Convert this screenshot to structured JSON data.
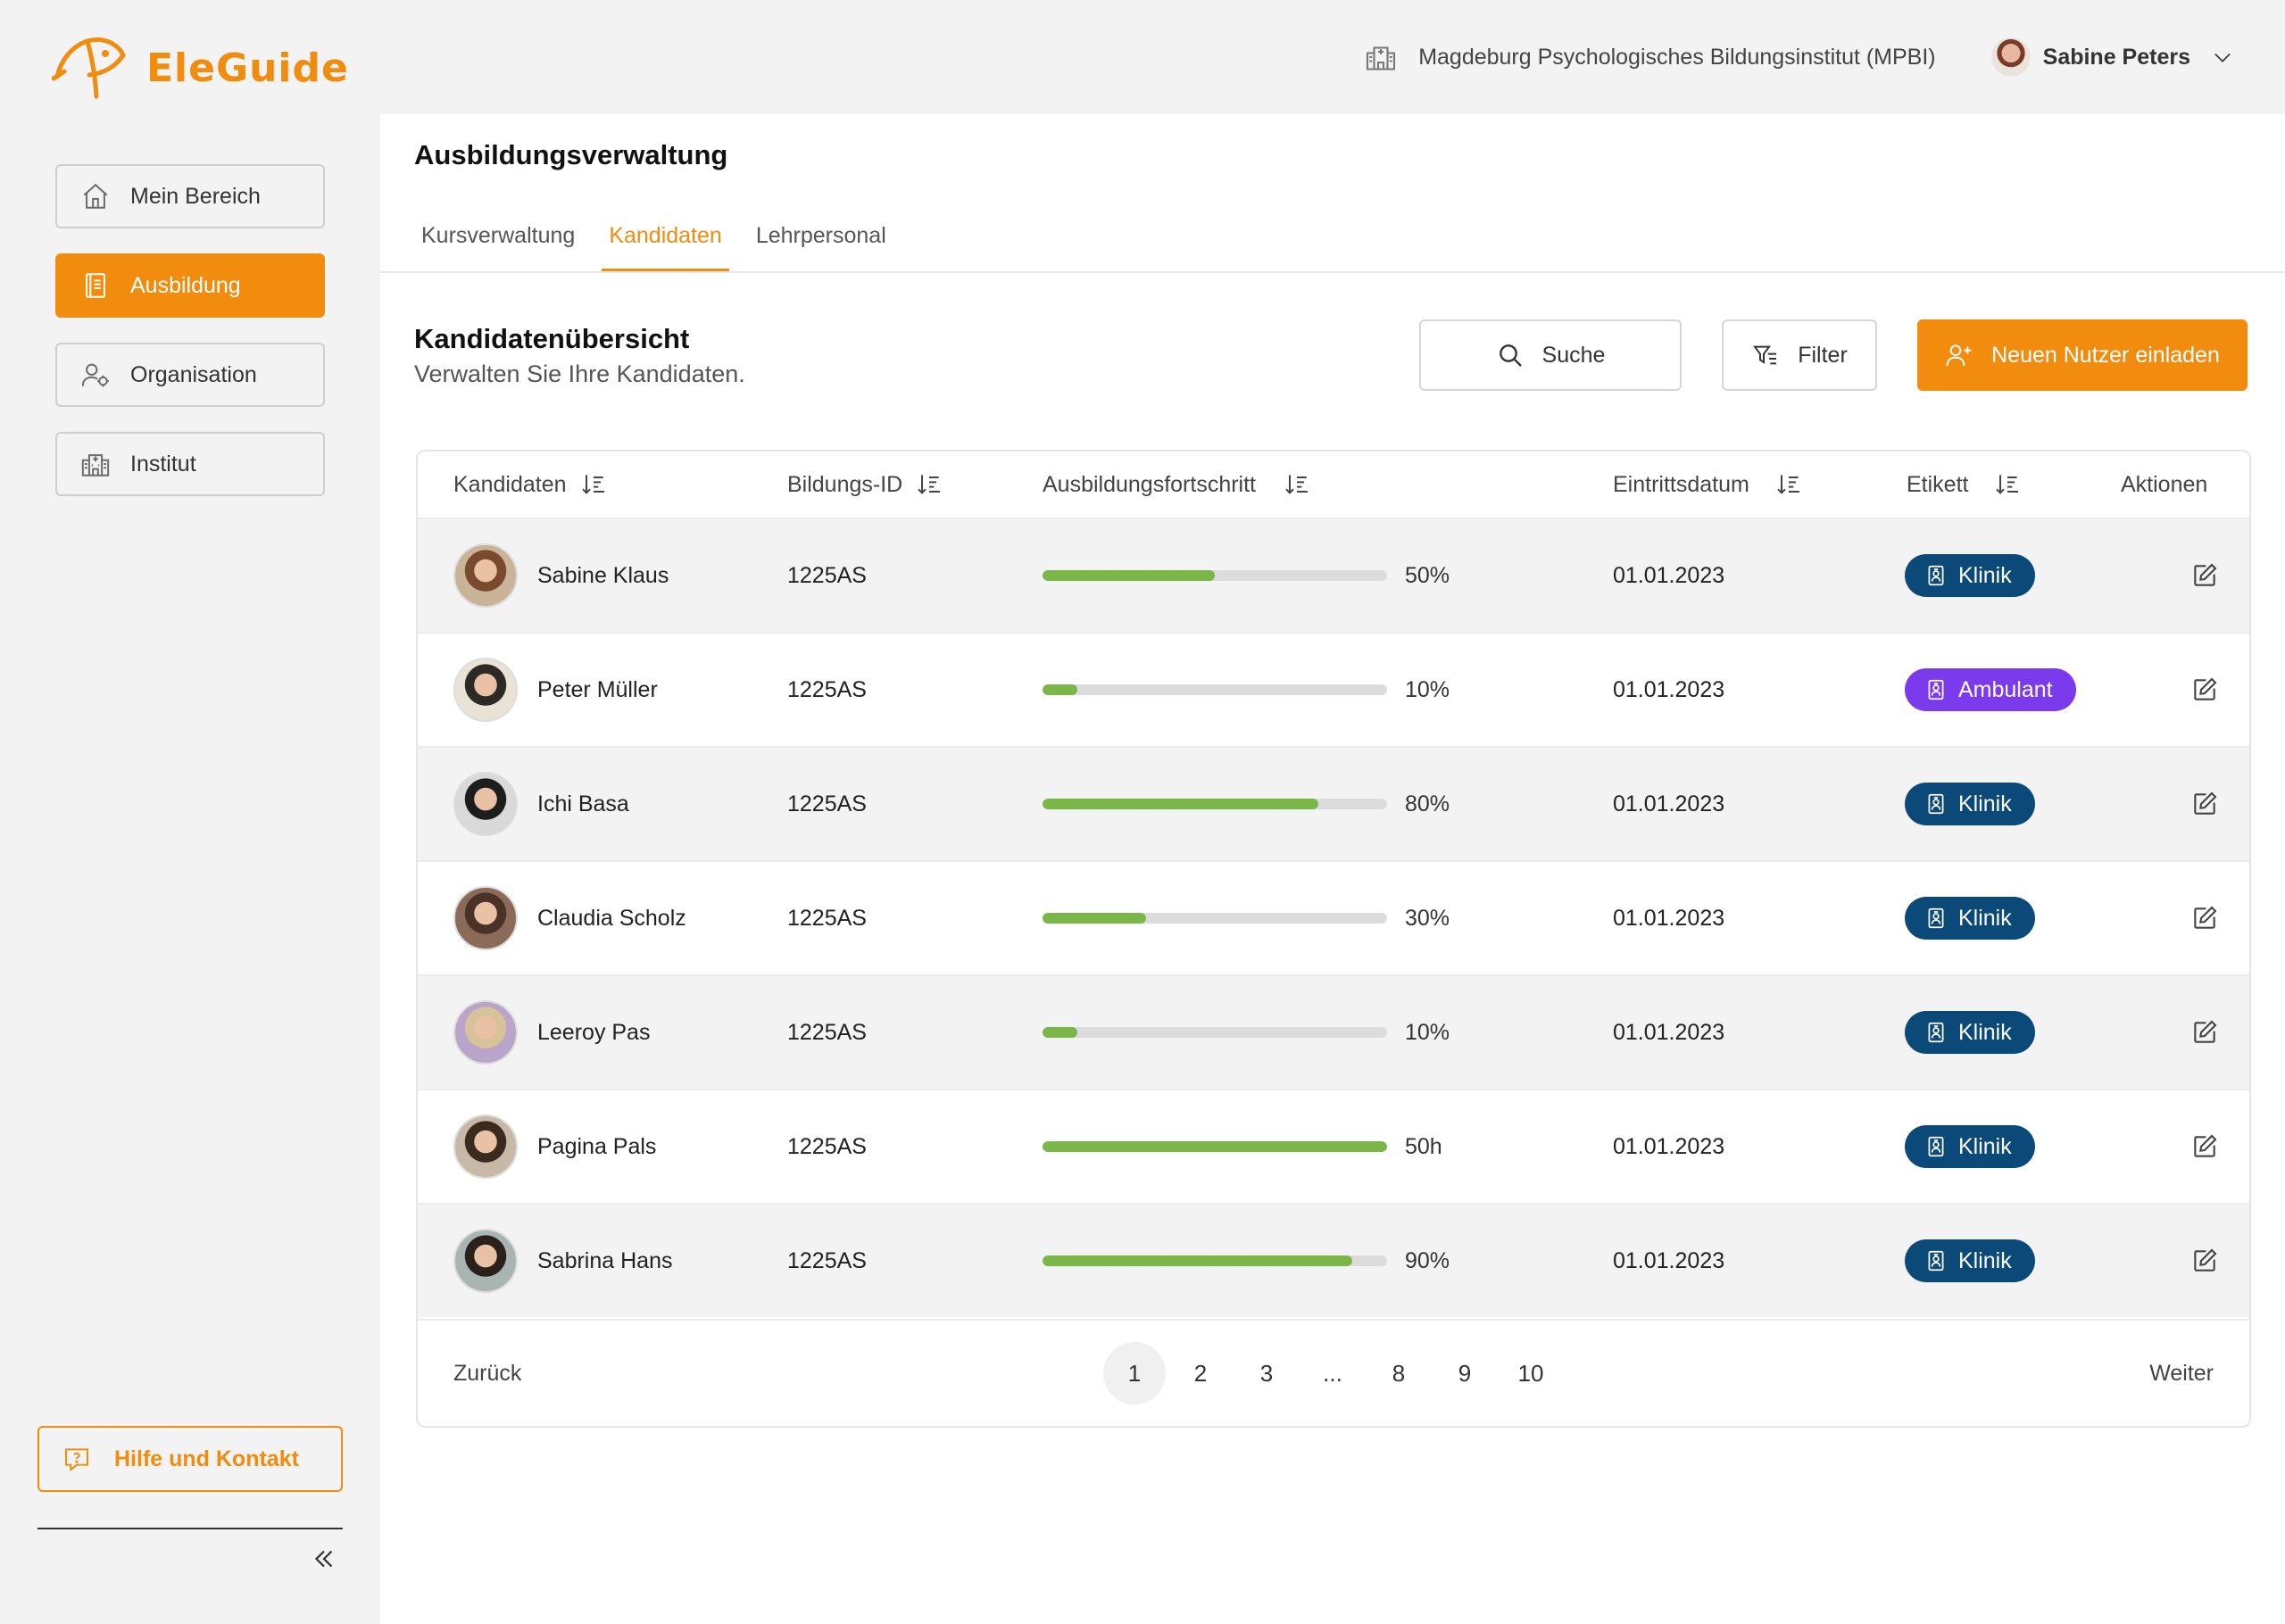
{
  "app": {
    "brand": "EleGuide",
    "brand_color": "#f28c0f"
  },
  "header": {
    "institution": "Magdeburg Psychologisches Bildungsinstitut (MPBI)",
    "user_name": "Sabine Peters"
  },
  "sidebar": {
    "items": [
      {
        "label": "Mein Bereich",
        "icon": "home-icon"
      },
      {
        "label": "Ausbildung",
        "icon": "book-icon",
        "active": true
      },
      {
        "label": "Organisation",
        "icon": "user-settings-icon"
      },
      {
        "label": "Institut",
        "icon": "building-icon"
      }
    ],
    "help_label": "Hilfe und Kontakt"
  },
  "main": {
    "title": "Ausbildungsverwaltung",
    "tabs": [
      {
        "label": "Kursverwaltung"
      },
      {
        "label": "Kandidaten",
        "active": true
      },
      {
        "label": "Lehrpersonal"
      }
    ],
    "section_title": "Kandidatenübersicht",
    "section_subtitle": "Verwalten Sie Ihre Kandidaten.",
    "search_label": "Suche",
    "filter_label": "Filter",
    "invite_label": "Neuen Nutzer einladen"
  },
  "table": {
    "headers": {
      "candidate": "Kandidaten",
      "id": "Bildungs-ID",
      "progress": "Ausbildungsfortschritt",
      "date": "Eintrittsdatum",
      "tag": "Etikett",
      "actions": "Aktionen"
    },
    "rows": [
      {
        "name": "Sabine Klaus",
        "id": "1225AS",
        "progress": 0.5,
        "progress_label": "50%",
        "date": "01.01.2023",
        "tag": "Klinik",
        "tag_color": "#0b4a78",
        "avatar_hair": "#7a4a2e",
        "avatar_bg": "#c9b49a"
      },
      {
        "name": "Peter Müller",
        "id": "1225AS",
        "progress": 0.1,
        "progress_label": "10%",
        "date": "01.01.2023",
        "tag": "Ambulant",
        "tag_color": "#7c3aed",
        "avatar_hair": "#2d2a26",
        "avatar_bg": "#e9e3d6"
      },
      {
        "name": "Ichi Basa",
        "id": "1225AS",
        "progress": 0.8,
        "progress_label": "80%",
        "date": "01.01.2023",
        "tag": "Klinik",
        "tag_color": "#0b4a78",
        "avatar_hair": "#1d1d1d",
        "avatar_bg": "#d9d9d9"
      },
      {
        "name": "Claudia Scholz",
        "id": "1225AS",
        "progress": 0.3,
        "progress_label": "30%",
        "date": "01.01.2023",
        "tag": "Klinik",
        "tag_color": "#0b4a78",
        "avatar_hair": "#4a3326",
        "avatar_bg": "#8a6a58"
      },
      {
        "name": "Leeroy Pas",
        "id": "1225AS",
        "progress": 0.1,
        "progress_label": "10%",
        "date": "01.01.2023",
        "tag": "Klinik",
        "tag_color": "#0b4a78",
        "avatar_hair": "#d8c29a",
        "avatar_bg": "#b9a5c9"
      },
      {
        "name": "Pagina Pals",
        "id": "1225AS",
        "progress": 1.0,
        "progress_label": "50h",
        "date": "01.01.2023",
        "tag": "Klinik",
        "tag_color": "#0b4a78",
        "avatar_hair": "#3a2a20",
        "avatar_bg": "#c8b8a6"
      },
      {
        "name": "Sabrina Hans",
        "id": "1225AS",
        "progress": 0.9,
        "progress_label": "90%",
        "date": "01.01.2023",
        "tag": "Klinik",
        "tag_color": "#0b4a78",
        "avatar_hair": "#2a211c",
        "avatar_bg": "#a8b5b0"
      }
    ]
  },
  "pagination": {
    "back": "Zurück",
    "next": "Weiter",
    "pages": [
      "1",
      "2",
      "3",
      "...",
      "8",
      "9",
      "10"
    ],
    "current": "1"
  }
}
